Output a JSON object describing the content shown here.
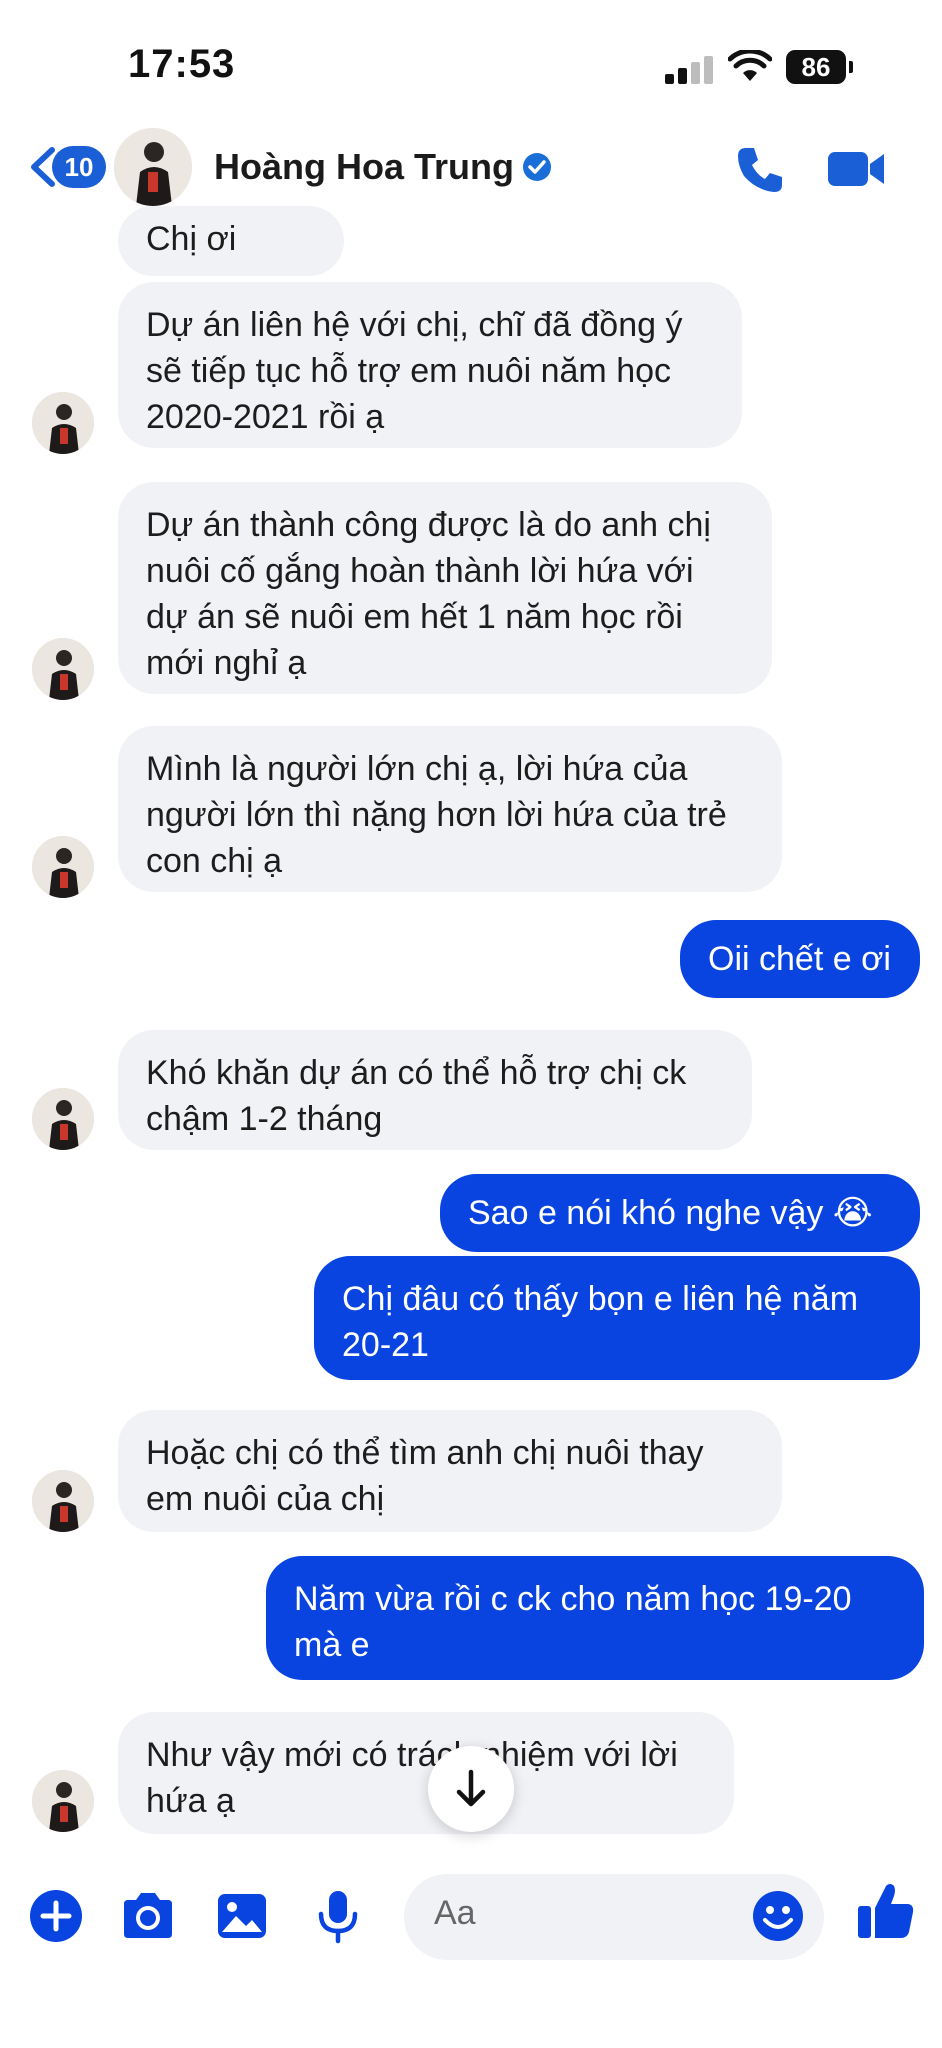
{
  "status_bar": {
    "time": "17:53",
    "battery": "86"
  },
  "header": {
    "back_badge": "10",
    "contact_name": "Hoàng Hoa Trung",
    "verified": true
  },
  "messages": [
    {
      "from": "them",
      "text": "Chị ơi"
    },
    {
      "from": "them",
      "text": "Dự án liên hệ với chị, chĩ đã đồng ý\nsẽ tiếp tục hỗ trợ em nuôi năm học\n2020-2021 rồi ạ"
    },
    {
      "from": "them",
      "text": "Dự án thành công được là do anh chị\nnuôi cố gắng hoàn thành lời hứa với\ndự án sẽ nuôi em hết 1 năm học rồi\nmới nghỉ ạ"
    },
    {
      "from": "them",
      "text": "Mình là người lớn chị ạ, lời hứa của\nngười lớn thì nặng hơn lời hứa của trẻ\ncon chị ạ"
    },
    {
      "from": "me",
      "text": "Oii chết e ơi"
    },
    {
      "from": "them",
      "text": "Khó khăn dự án có thể hỗ trợ chị ck\nchậm 1-2 tháng"
    },
    {
      "from": "me",
      "text": "Sao e nói khó nghe vậy 😭"
    },
    {
      "from": "me",
      "text": "Chị đâu có thấy bọn e liên hệ năm\n20-21"
    },
    {
      "from": "them",
      "text": "Hoặc chị có thể tìm anh chị nuôi thay\nem nuôi của chị"
    },
    {
      "from": "me",
      "text": "Năm vừa rồi c ck cho năm học 19-20\nmà e"
    },
    {
      "from": "them",
      "text": "Như vậy mới có trách nhiệm với lời\nhứa ạ"
    }
  ],
  "composer": {
    "placeholder": "Aa"
  },
  "colors": {
    "accent": "#1a5fd6",
    "outgoing_bubble": "#0a44e0",
    "incoming_bubble": "#f1f2f6"
  },
  "icons": [
    "back-chevron-icon",
    "verified-badge-icon",
    "phone-icon",
    "video-camera-icon",
    "arrow-down-icon",
    "plus-icon",
    "camera-icon",
    "image-icon",
    "microphone-icon",
    "emoji-icon",
    "thumbs-up-icon"
  ]
}
